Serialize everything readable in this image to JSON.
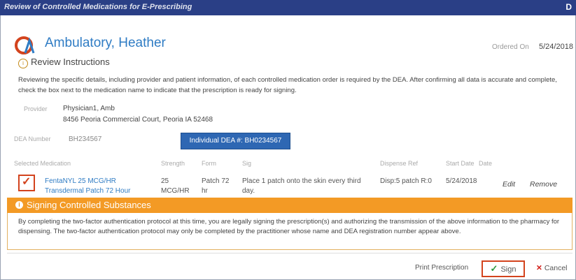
{
  "window": {
    "title": "Review of Controlled Medications for E-Prescribing",
    "close": "D"
  },
  "patient": {
    "name": "Ambulatory, Heather",
    "ordered_label": "Ordered On",
    "ordered_date": "5/24/2018"
  },
  "review": {
    "title": "Review Instructions",
    "text": "Reviewing the specific details, including provider and patient information, of each controlled medication order is required by the DEA. After confirming all data is accurate and complete, check the box next to the medication name to indicate that the prescription is ready for signing."
  },
  "provider": {
    "label": "Provider",
    "name": "Physician1, Amb",
    "address": "8456 Peoria Commercial Court, Peoria IA 52468"
  },
  "dea": {
    "label": "DEA Number",
    "value": "BH234567",
    "individual": "Individual DEA #: BH0234567"
  },
  "columns": [
    "Selected Medication",
    "Strength",
    "Form",
    "Sig",
    "Dispense Ref",
    "Start Date",
    "Date"
  ],
  "medication": {
    "name_line1": "FentaNYL 25 MCG/HR",
    "name_line2": "Transdermal Patch 72 Hour",
    "strength_line1": "25",
    "strength_line2": "MCG/HR",
    "form_line1": "Patch 72",
    "form_line2": "hr",
    "sig_line1": "Place 1 patch onto the skin every third",
    "sig_line2": "day.",
    "dispense": "Disp:5 patch R:0",
    "start_date": "5/24/2018",
    "edit": "Edit",
    "remove": "Remove"
  },
  "signing": {
    "title": "Signing Controlled Substances",
    "text": "By completing the two-factor authentication protocol at this time, you are legally signing the prescription(s) and authorizing the transmission of the above information to the pharmacy for dispensing. The two-factor authentication protocol may only be completed by the practitioner whose name and DEA registration number appear above."
  },
  "footer": {
    "print": "Print Prescription",
    "sign": "Sign",
    "cancel": "Cancel"
  },
  "colors": {
    "accent": "#2f7cc4",
    "warning": "#f39a25",
    "highlight": "#d3431d"
  },
  "icons": [
    "logo-icon",
    "info-icon",
    "checkmark-icon",
    "close-icon"
  ]
}
